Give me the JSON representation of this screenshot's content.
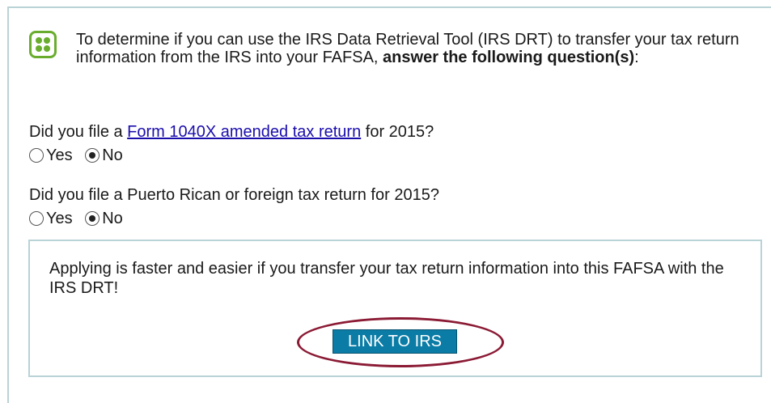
{
  "intro": {
    "text_before": "To determine if you can use the IRS Data Retrieval Tool (IRS DRT) to transfer your tax return information from the IRS into your FAFSA, ",
    "text_bold": "answer the following question(s)",
    "text_after": ":"
  },
  "questions": [
    {
      "before": "Did you file a ",
      "link": "Form 1040X amended tax return",
      "after": " for 2015?",
      "options": [
        "Yes",
        "No"
      ],
      "selected": "No"
    },
    {
      "text": "Did you file a Puerto Rican or foreign tax return for 2015?",
      "options": [
        "Yes",
        "No"
      ],
      "selected": "No"
    }
  ],
  "box": {
    "message": "Applying is faster and easier if you transfer your tax return information into this FAFSA with the IRS DRT!",
    "button_label": "LINK TO IRS"
  },
  "colors": {
    "accent_green": "#6aad2e",
    "border_teal": "#b9d3d6",
    "button_blue": "#0a7ca6",
    "highlight_circle": "#8b1a34",
    "link": "#1a0dab"
  },
  "icons": {
    "help": "help-dots-icon"
  }
}
